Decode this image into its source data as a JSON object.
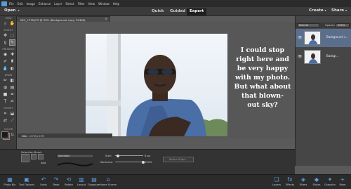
{
  "menu": [
    "File",
    "Edit",
    "Image",
    "Enhance",
    "Layer",
    "Select",
    "Filter",
    "View",
    "Window",
    "Help"
  ],
  "modebar": {
    "open_label": "Open",
    "modes": [
      "Quick",
      "Guided",
      "Expert"
    ],
    "active_mode": "Expert",
    "create_label": "Create",
    "share_label": "Share"
  },
  "toolbox": {
    "sections": [
      "VIEW",
      "SELECT",
      "ENHANCE",
      "DRAW",
      "MODIFY",
      "COLOR"
    ]
  },
  "document": {
    "tab_title": "IMG_7378.JPG @ 36% (Background copy, RGB/8)",
    "zoom_status": "36%",
    "doc_info": "Doc: 1.67M/1.67M"
  },
  "overlay_text": [
    "I could stop",
    "right here and",
    "be very happy",
    "with my photo.",
    "But what about",
    "that blown-",
    "out sky?"
  ],
  "layers": {
    "blend_mode": "Normal",
    "opacity_label": "Opacity:",
    "opacity_value": "100%",
    "items": [
      {
        "name": "Background c...",
        "selected": true
      },
      {
        "name": "Backgr...",
        "selected": false
      }
    ]
  },
  "options": {
    "tool_name": "Selection Brush",
    "mode_label": "Add",
    "selection_value": "Selection",
    "size_label": "Size:",
    "size_value": "6 px",
    "hardness_label": "Hardness:",
    "hardness_value": "100%",
    "refine_label": "Refine Edge...",
    "hardness_level": 1.0
  },
  "taskbar_left": [
    "Photo Bin",
    "Tool Options",
    "Undo",
    "Redo",
    "Rotate",
    "Layout",
    "Organizer",
    "Home Screen"
  ],
  "taskbar_right": [
    "Layers",
    "Effects",
    "Filters",
    "Styles",
    "Graphics",
    "More"
  ],
  "colors": {
    "accent": "#5ea0e6",
    "foreground": "#1b1b1b",
    "background": "#6a3a2a"
  }
}
